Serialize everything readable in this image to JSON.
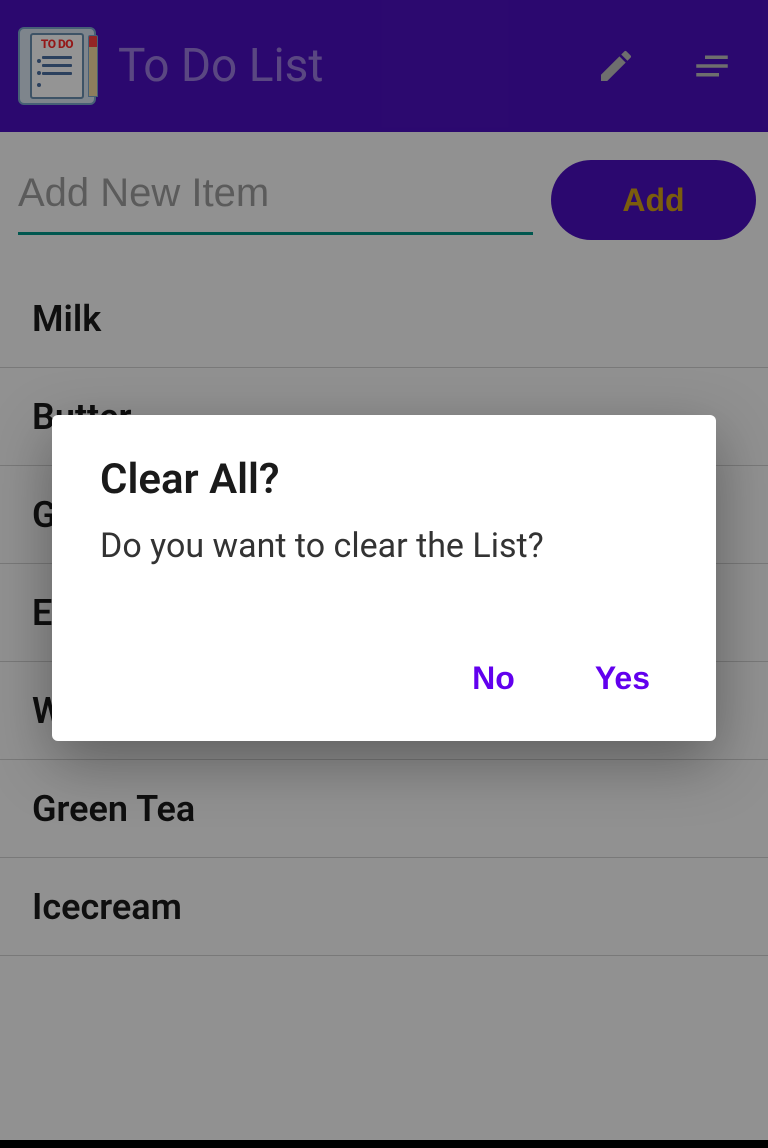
{
  "header": {
    "title": "To Do List"
  },
  "input": {
    "placeholder": "Add New Item",
    "value": "",
    "addLabel": "Add"
  },
  "items": [
    {
      "label": "Milk"
    },
    {
      "label": "Butter"
    },
    {
      "label": "Grapes"
    },
    {
      "label": "Eggs"
    },
    {
      "label": "Water"
    },
    {
      "label": "Green Tea"
    },
    {
      "label": "Icecream"
    }
  ],
  "dialog": {
    "title": "Clear All?",
    "message": "Do you want to clear the List?",
    "no": "No",
    "yes": "Yes"
  }
}
